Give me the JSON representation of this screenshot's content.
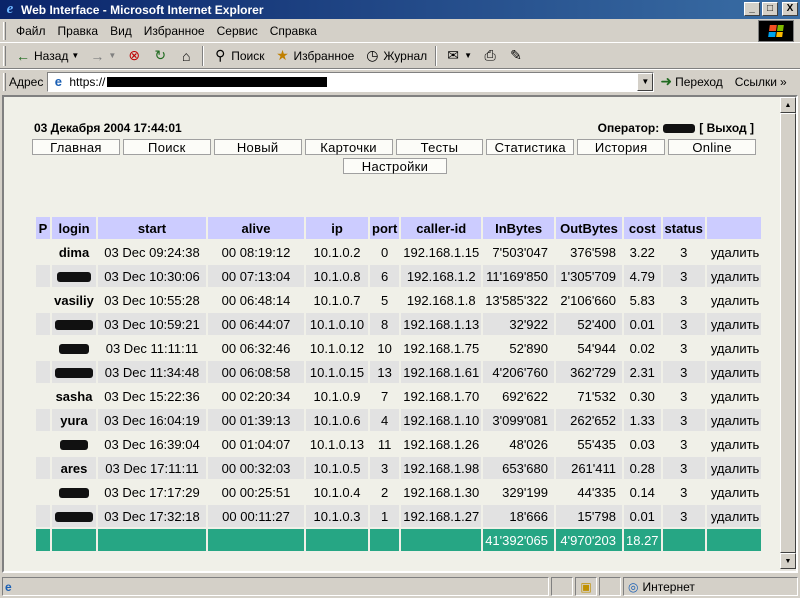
{
  "window": {
    "title": "Web Interface - Microsoft Internet Explorer",
    "buttons": [
      "_",
      "□",
      "X"
    ]
  },
  "menubar": {
    "items": [
      "Файл",
      "Правка",
      "Вид",
      "Избранное",
      "Сервис",
      "Справка"
    ]
  },
  "toolbar": {
    "back": "Назад",
    "search": "Поиск",
    "favorites": "Избранное",
    "history": "Журнал"
  },
  "address": {
    "label": "Адрес",
    "url_prefix": "https://",
    "go": "Переход",
    "links": "Ссылки"
  },
  "page": {
    "datetime": "03 Декабря 2004 17:44:01",
    "operator_label": "Оператор:",
    "logout": "[ Выход ]",
    "nav": [
      "Главная",
      "Поиск",
      "Новый",
      "Карточки",
      "Тесты",
      "Статистика",
      "История",
      "Online"
    ],
    "nav2": "Настройки"
  },
  "table": {
    "columns": [
      "P",
      "login",
      "start",
      "alive",
      "ip",
      "port",
      "caller-id",
      "InBytes",
      "OutBytes",
      "cost",
      "status",
      ""
    ],
    "rows": [
      {
        "login": "dima",
        "start": "03 Dec 09:24:38",
        "alive": "00 08:19:12",
        "ip": "10.1.0.2",
        "port": "0",
        "caller": "192.168.1.15",
        "inb": "7'503'047",
        "outb": "376'598",
        "cost": "3.22",
        "status": "3",
        "action": "удалить"
      },
      {
        "login": "",
        "start": "03 Dec 10:30:06",
        "alive": "00 07:13:04",
        "ip": "10.1.0.8",
        "port": "6",
        "caller": "192.168.1.2",
        "inb": "11'169'850",
        "outb": "1'305'709",
        "cost": "4.79",
        "status": "3",
        "action": "удалить"
      },
      {
        "login": "vasiliy",
        "start": "03 Dec 10:55:28",
        "alive": "00 06:48:14",
        "ip": "10.1.0.7",
        "port": "5",
        "caller": "192.168.1.8",
        "inb": "13'585'322",
        "outb": "2'106'660",
        "cost": "5.83",
        "status": "3",
        "action": "удалить"
      },
      {
        "login": "",
        "start": "03 Dec 10:59:21",
        "alive": "00 06:44:07",
        "ip": "10.1.0.10",
        "port": "8",
        "caller": "192.168.1.13",
        "inb": "32'922",
        "outb": "52'400",
        "cost": "0.01",
        "status": "3",
        "action": "удалить"
      },
      {
        "login": "",
        "start": "03 Dec 11:11:11",
        "alive": "00 06:32:46",
        "ip": "10.1.0.12",
        "port": "10",
        "caller": "192.168.1.75",
        "inb": "52'890",
        "outb": "54'944",
        "cost": "0.02",
        "status": "3",
        "action": "удалить"
      },
      {
        "login": "",
        "start": "03 Dec 11:34:48",
        "alive": "00 06:08:58",
        "ip": "10.1.0.15",
        "port": "13",
        "caller": "192.168.1.61",
        "inb": "4'206'760",
        "outb": "362'729",
        "cost": "2.31",
        "status": "3",
        "action": "удалить"
      },
      {
        "login": "sasha",
        "start": "03 Dec 15:22:36",
        "alive": "00 02:20:34",
        "ip": "10.1.0.9",
        "port": "7",
        "caller": "192.168.1.70",
        "inb": "692'622",
        "outb": "71'532",
        "cost": "0.30",
        "status": "3",
        "action": "удалить"
      },
      {
        "login": "yura",
        "start": "03 Dec 16:04:19",
        "alive": "00 01:39:13",
        "ip": "10.1.0.6",
        "port": "4",
        "caller": "192.168.1.10",
        "inb": "3'099'081",
        "outb": "262'652",
        "cost": "1.33",
        "status": "3",
        "action": "удалить"
      },
      {
        "login": "",
        "start": "03 Dec 16:39:04",
        "alive": "00 01:04:07",
        "ip": "10.1.0.13",
        "port": "11",
        "caller": "192.168.1.26",
        "inb": "48'026",
        "outb": "55'435",
        "cost": "0.03",
        "status": "3",
        "action": "удалить"
      },
      {
        "login": "ares",
        "start": "03 Dec 17:11:11",
        "alive": "00 00:32:03",
        "ip": "10.1.0.5",
        "port": "3",
        "caller": "192.168.1.98",
        "inb": "653'680",
        "outb": "261'411",
        "cost": "0.28",
        "status": "3",
        "action": "удалить"
      },
      {
        "login": "",
        "start": "03 Dec 17:17:29",
        "alive": "00 00:25:51",
        "ip": "10.1.0.4",
        "port": "2",
        "caller": "192.168.1.30",
        "inb": "329'199",
        "outb": "44'335",
        "cost": "0.14",
        "status": "3",
        "action": "удалить"
      },
      {
        "login": "",
        "start": "03 Dec 17:32:18",
        "alive": "00 00:11:27",
        "ip": "10.1.0.3",
        "port": "1",
        "caller": "192.168.1.27",
        "inb": "18'666",
        "outb": "15'798",
        "cost": "0.01",
        "status": "3",
        "action": "удалить"
      }
    ],
    "totals": {
      "inb": "41'392'065",
      "outb": "4'970'203",
      "cost": "18.27"
    }
  },
  "statusbar": {
    "zone": "Интернет"
  },
  "colors": {
    "header_bg": "#ccccff",
    "alt_row": "#e2e2e2",
    "total_row": "#26a684",
    "titlebar": "#0a246a"
  }
}
